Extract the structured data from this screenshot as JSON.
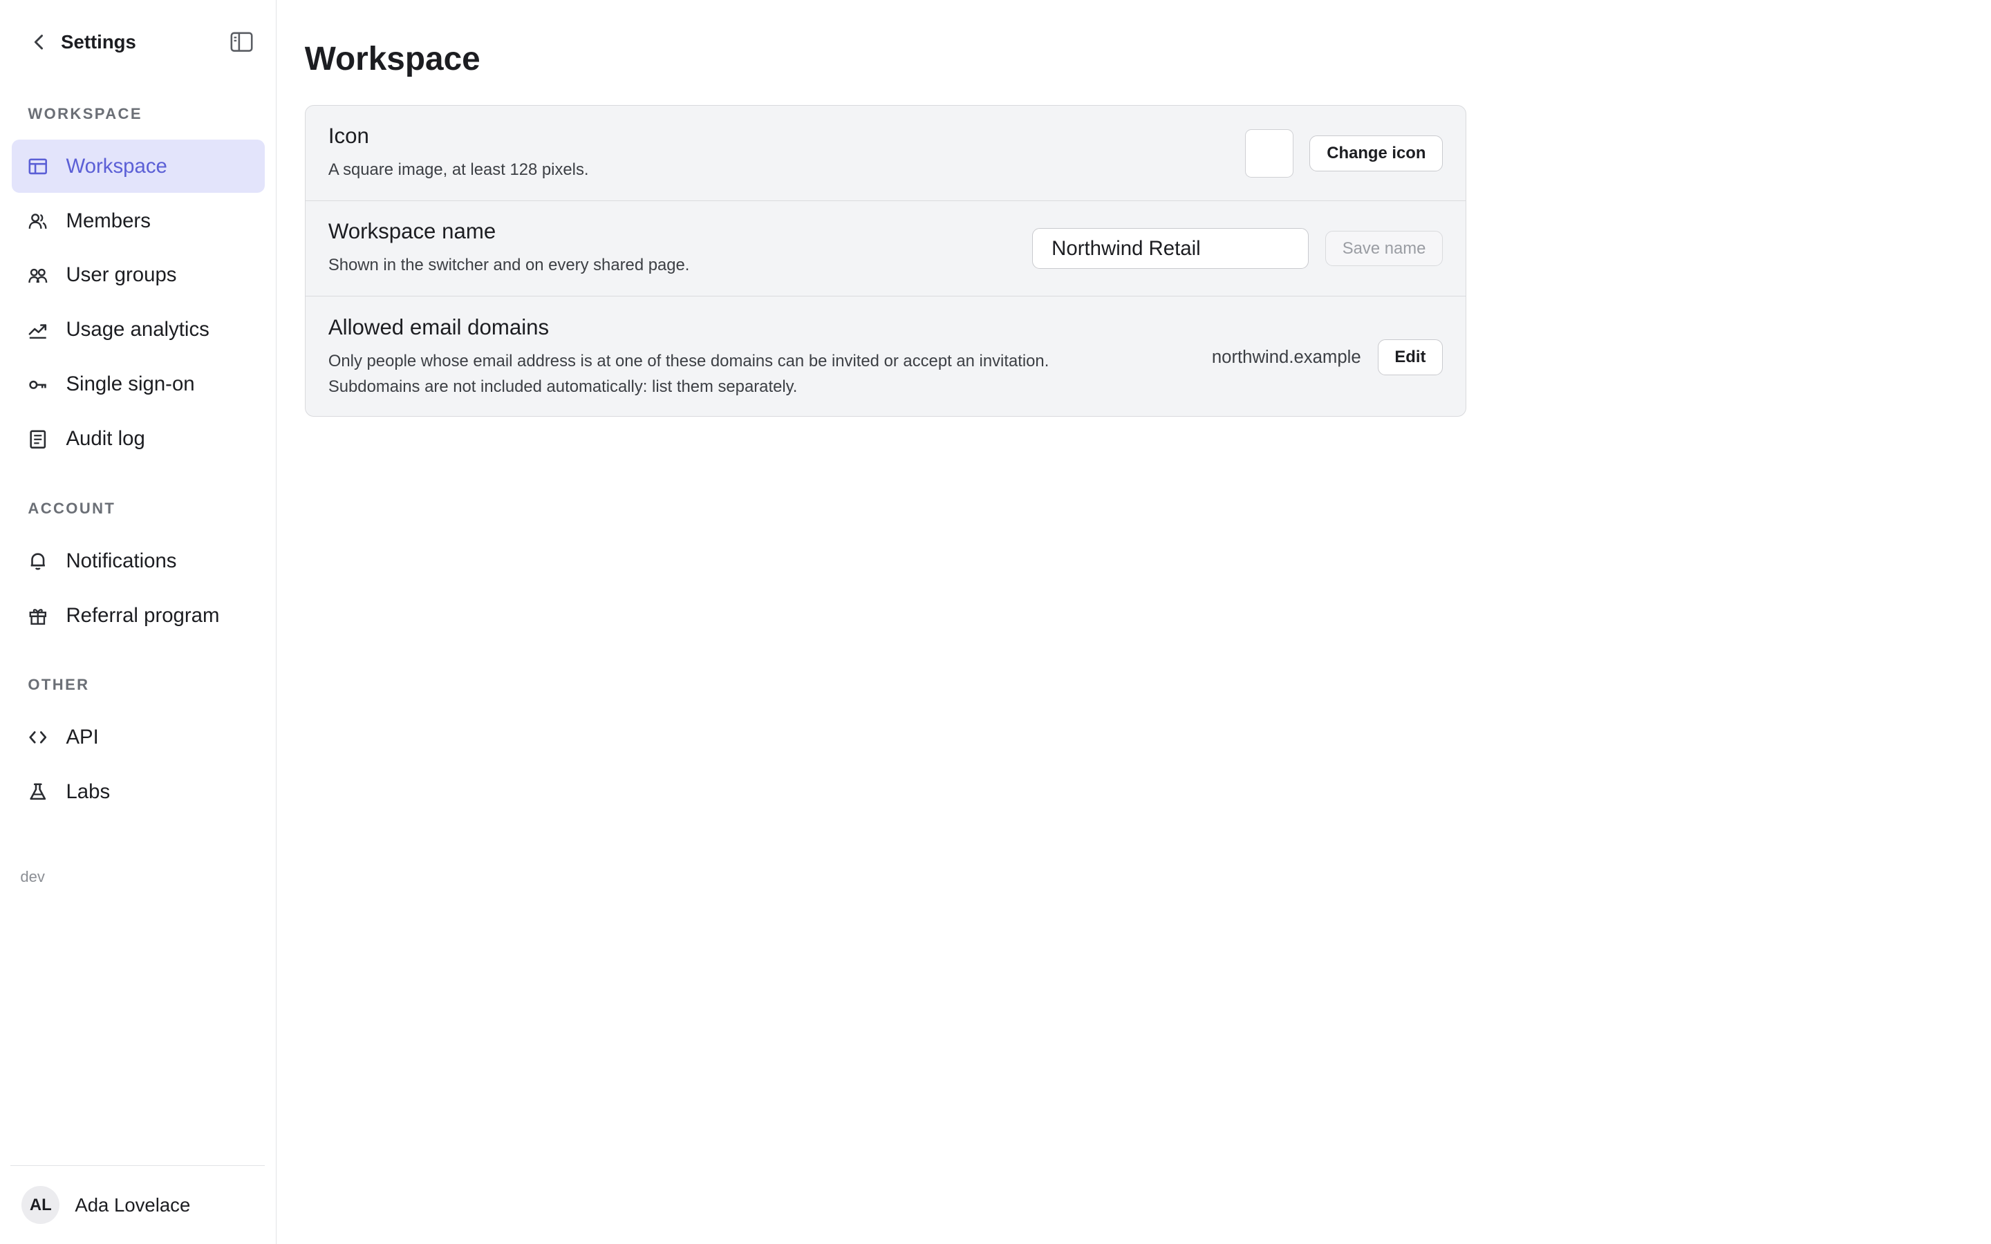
{
  "sidebar": {
    "title": "Settings",
    "sections": [
      {
        "label": "WORKSPACE"
      },
      {
        "label": "ACCOUNT"
      },
      {
        "label": "OTHER"
      }
    ],
    "items": [
      {
        "label": "Workspace",
        "icon": "layout-icon"
      },
      {
        "label": "Members",
        "icon": "members-icon"
      },
      {
        "label": "User groups",
        "icon": "user-groups-icon"
      },
      {
        "label": "Usage analytics",
        "icon": "trend-icon"
      },
      {
        "label": "Single sign-on",
        "icon": "key-icon"
      },
      {
        "label": "Audit log",
        "icon": "document-icon"
      },
      {
        "label": "Notifications",
        "icon": "bell-icon"
      },
      {
        "label": "Referral program",
        "icon": "gift-icon"
      },
      {
        "label": "API",
        "icon": "code-icon"
      },
      {
        "label": "Labs",
        "icon": "flask-icon"
      }
    ],
    "env_label": "dev",
    "user": {
      "initials": "AL",
      "name": "Ada Lovelace"
    }
  },
  "main": {
    "title": "Workspace",
    "icon_row": {
      "title": "Icon",
      "description": "A square image, at least 128 pixels.",
      "button": "Change icon"
    },
    "name_row": {
      "title": "Workspace name",
      "description": "Shown in the switcher and on every shared page.",
      "input_value": "Northwind Retail",
      "button": "Save name"
    },
    "domains_row": {
      "title": "Allowed email domains",
      "description_line1": "Only people whose email address is at one of these domains can be invited or accept an invitation.",
      "description_line2": "Subdomains are not included automatically: list them separately.",
      "value": "northwind.example",
      "button": "Edit"
    }
  },
  "colors": {
    "accent": "#5b5fd6",
    "active_bg": "#e3e4fb",
    "card_bg": "#f3f4f6"
  }
}
